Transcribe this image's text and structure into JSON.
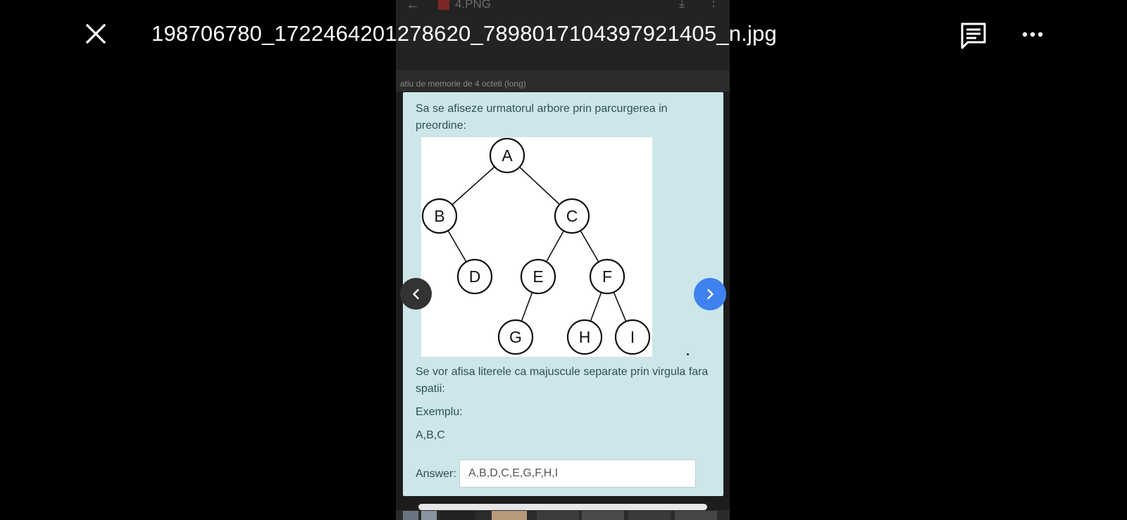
{
  "viewer": {
    "filename": "198706780_1722464201278620_7898017104397921405_n.jpg"
  },
  "phone": {
    "header_filename": "4.PNG",
    "strip_text": "atiu de memorie de 4 octeti (long)"
  },
  "question": {
    "prompt": "Sa se afiseze urmatorul arbore prin parcurgerea in preordine:",
    "note": "Se vor afisa literele ca majuscule separate prin virgula fara spatii:",
    "example_label": "Exemplu:",
    "example_value": "A,B,C",
    "answer_label": "Answer:",
    "answer_value": "A,B,D,C,E,G,F,H,I"
  },
  "tree": {
    "nodes": [
      "A",
      "B",
      "C",
      "D",
      "E",
      "F",
      "G",
      "H",
      "I"
    ],
    "edges": [
      [
        "A",
        "B"
      ],
      [
        "A",
        "C"
      ],
      [
        "B",
        "D"
      ],
      [
        "C",
        "E"
      ],
      [
        "C",
        "F"
      ],
      [
        "E",
        "G"
      ],
      [
        "F",
        "H"
      ],
      [
        "F",
        "I"
      ]
    ]
  },
  "colors": {
    "card_bg": "#cde6ea",
    "next_button": "#3d82ef",
    "prev_button": "#333333",
    "text": "#2f4f56"
  },
  "icons": {
    "close": "close-icon",
    "comment": "comment-icon",
    "more": "more-horizontal-icon",
    "prev": "chevron-left-icon",
    "next": "chevron-right-icon"
  }
}
